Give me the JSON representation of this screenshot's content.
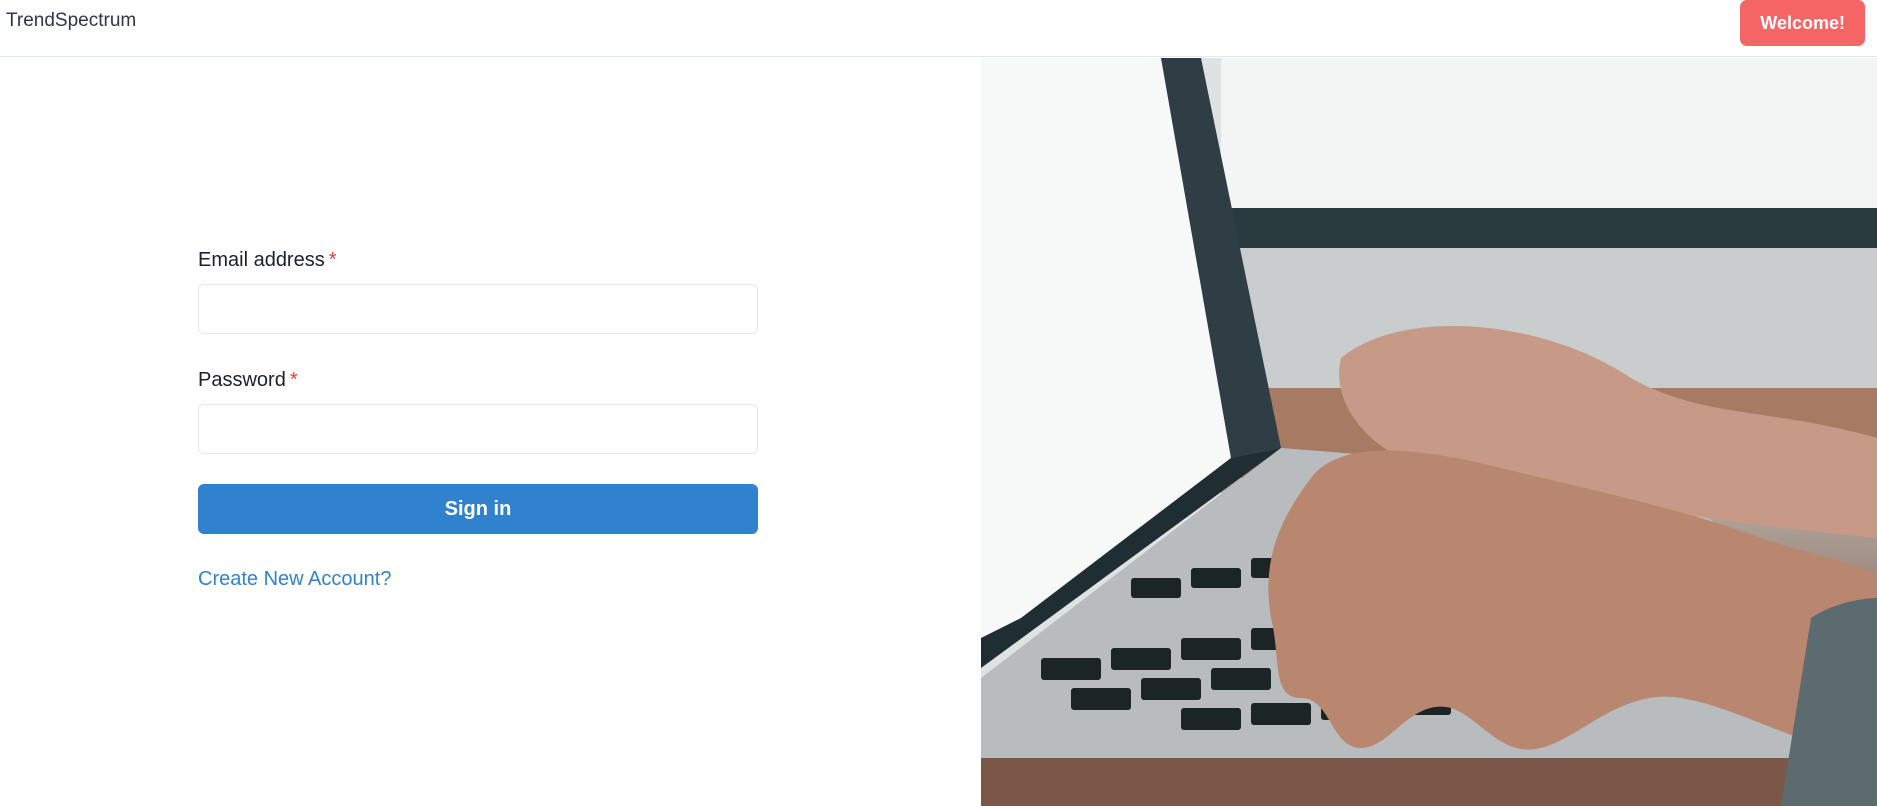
{
  "header": {
    "brand": "TrendSpectrum",
    "welcome_label": "Welcome!"
  },
  "form": {
    "email_label": "Email address",
    "email_required": "*",
    "email_value": "",
    "password_label": "Password",
    "password_required": "*",
    "password_value": "",
    "signin_label": "Sign in",
    "create_account_label": "Create New Account?"
  },
  "hero": {
    "image_subject": "hands typing on laptop keyboard"
  },
  "colors": {
    "primary": "#3182ce",
    "welcome": "#f56565",
    "required": "#e53e3e"
  }
}
